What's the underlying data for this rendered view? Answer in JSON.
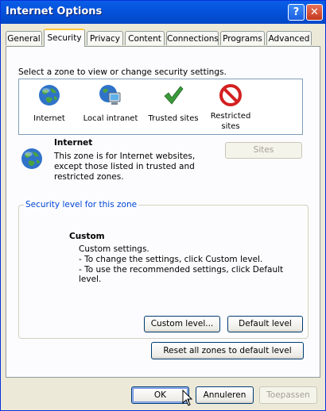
{
  "window": {
    "title": "Internet Options",
    "help_glyph": "?",
    "close_glyph": "✕"
  },
  "tabs": [
    {
      "label": "General"
    },
    {
      "label": "Security"
    },
    {
      "label": "Privacy"
    },
    {
      "label": "Content"
    },
    {
      "label": "Connections"
    },
    {
      "label": "Programs"
    },
    {
      "label": "Advanced"
    }
  ],
  "security": {
    "select_zone_text": "Select a zone to view or change security settings.",
    "zones": [
      {
        "label": "Internet",
        "icon": "globe-icon"
      },
      {
        "label": "Local intranet",
        "icon": "intranet-icon"
      },
      {
        "label": "Trusted sites",
        "icon": "checkmark-icon"
      },
      {
        "label": "Restricted sites",
        "icon": "restricted-icon"
      }
    ],
    "selected_zone": {
      "name": "Internet",
      "description": "This zone is for Internet websites, except those listed in trusted and restricted zones."
    },
    "sites_button": "Sites",
    "level_group_label": "Security level for this zone",
    "level": {
      "title": "Custom",
      "line1": "Custom settings.",
      "line2": "- To change the settings, click Custom level.",
      "line3": "- To use the recommended settings, click Default level."
    },
    "custom_level_button": "Custom level...",
    "default_level_button": "Default level",
    "reset_all_button": "Reset all zones to default level"
  },
  "footer": {
    "ok": "OK",
    "cancel": "Annuleren",
    "apply": "Toepassen"
  },
  "colors": {
    "titlebar": "#0453dc",
    "face": "#ece9d8",
    "panel": "#fcfcfe",
    "group_label": "#0046d5"
  }
}
